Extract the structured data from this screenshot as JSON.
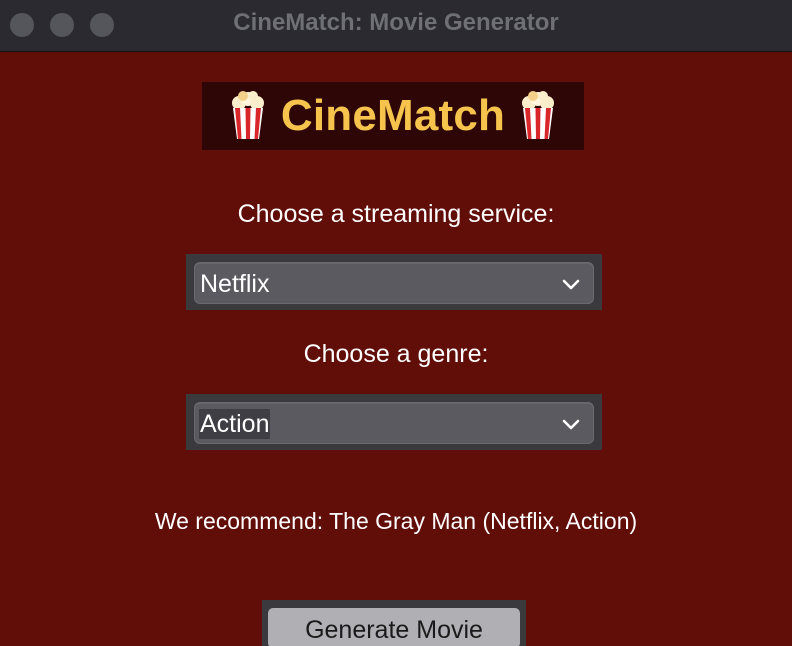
{
  "window": {
    "title": "CineMatch: Movie Generator",
    "traffic_lights": [
      "close",
      "minimize",
      "zoom"
    ]
  },
  "banner": {
    "title": "CineMatch",
    "icon_left": "popcorn-icon",
    "icon_right": "popcorn-icon"
  },
  "service": {
    "label": "Choose a streaming service:",
    "selected": "Netflix"
  },
  "genre": {
    "label": "Choose a genre:",
    "selected": "Action"
  },
  "result": {
    "text": "We recommend: The Gray Man (Netflix, Action)"
  },
  "generate_button": {
    "label": "Generate Movie"
  },
  "colors": {
    "background": "#610d08",
    "banner_bg": "#2d0605",
    "banner_text": "#f6c44c",
    "titlebar": "#2a2a30",
    "select_bg": "#5b5a61",
    "button_bg": "#b0b0b4"
  }
}
